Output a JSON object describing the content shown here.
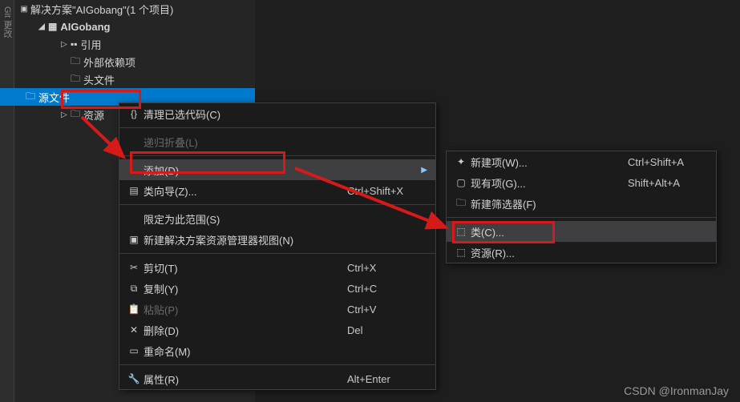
{
  "side_tab": "Git 更改",
  "tree": {
    "solution_label": "解决方案\"AIGobang\"(1 个项目)",
    "project": "AIGobang",
    "refs": "引用",
    "external": "外部依赖项",
    "headers": "头文件",
    "sources": "源文件",
    "resources": "资源"
  },
  "menu": {
    "clean": "清理已选代码(C)",
    "collapse": "递归折叠(L)",
    "add": "添加(D)",
    "class_wizard": "类向导(Z)...",
    "class_wizard_short": "Ctrl+Shift+X",
    "scope": "限定为此范围(S)",
    "new_view": "新建解决方案资源管理器视图(N)",
    "cut": "剪切(T)",
    "cut_short": "Ctrl+X",
    "copy": "复制(Y)",
    "copy_short": "Ctrl+C",
    "paste": "粘贴(P)",
    "paste_short": "Ctrl+V",
    "delete": "删除(D)",
    "delete_short": "Del",
    "rename": "重命名(M)",
    "properties": "属性(R)",
    "properties_short": "Alt+Enter"
  },
  "submenu": {
    "new_item": "新建项(W)...",
    "new_item_short": "Ctrl+Shift+A",
    "existing_item": "现有项(G)...",
    "existing_item_short": "Shift+Alt+A",
    "new_filter": "新建筛选器(F)",
    "class": "类(C)...",
    "resource": "资源(R)..."
  },
  "watermark": "CSDN @IronmanJay"
}
